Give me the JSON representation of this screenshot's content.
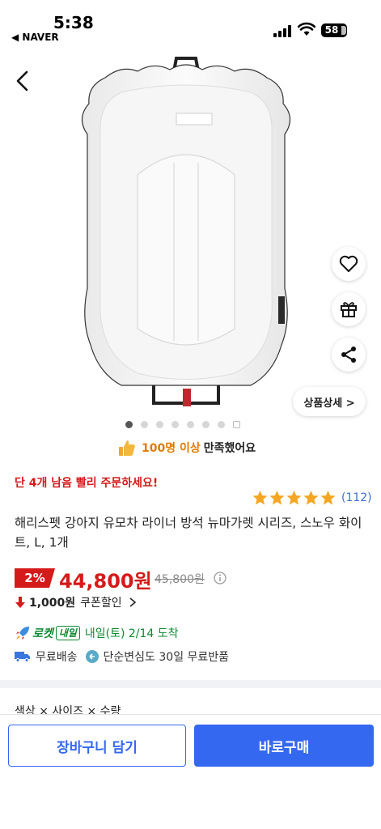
{
  "status_bar": {
    "time": "5:38",
    "back_app": "◀ NAVER",
    "battery": "58"
  },
  "product": {
    "satisfaction_count": "100명 이상",
    "satisfaction_text": "만족했어요",
    "stock_notice": "단 4개 남음 빨리 주문하세요!",
    "rating_stars": 5,
    "review_count": "(112)",
    "title": "해리스펫 강아지 유모차 라이너 방석 뉴마가렛 시리즈, 스노우 화이트, L, 1개",
    "discount": "2%",
    "price": "44,800원",
    "original_price": "45,800원",
    "coupon_amount": "1,000원",
    "coupon_label": "쿠폰할인"
  },
  "gallery": {
    "total_images": 7,
    "active_index": 0,
    "detail_button": "상품상세 >"
  },
  "delivery": {
    "rocket_label": "로켓",
    "rocket_badge": "내일",
    "eta": "내일(토) 2/14 도착",
    "free_shipping": "무료배송",
    "free_return": "단순변심도 30일 무료반품"
  },
  "options_label": "색상 × 사이즈 × 수량",
  "actions": {
    "cart": "장바구니 담기",
    "buy": "바로구매"
  },
  "colors": {
    "accent": "#3468f0",
    "sale_red": "#d51a1a",
    "rocket_green": "#0a8a2f",
    "star": "#f5a623"
  },
  "icons": [
    "back-chevron-icon",
    "heart-icon",
    "gift-icon",
    "share-icon",
    "thumbs-up-icon",
    "star-icon",
    "info-icon",
    "down-arrow-icon",
    "chevron-right-icon",
    "rocket-icon",
    "truck-icon",
    "return-icon"
  ]
}
